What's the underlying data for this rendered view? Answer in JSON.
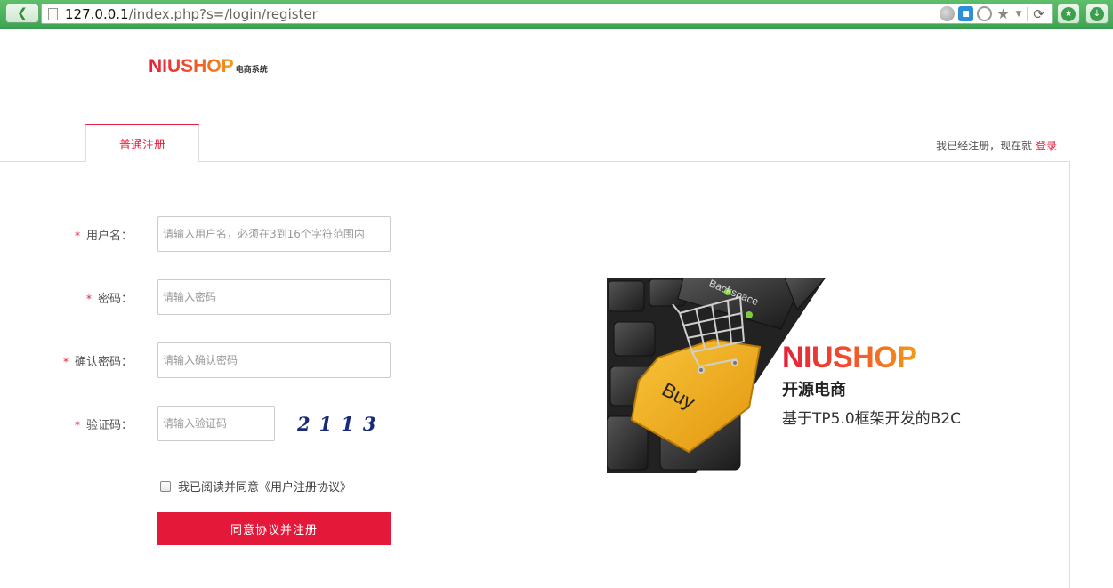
{
  "browser": {
    "url_host": "127.0.0.1",
    "url_path": "/index.php?s=/login/register"
  },
  "logo": {
    "main": "NIUSHOP",
    "sub": "电商系统"
  },
  "tabs": [
    {
      "label": "普通注册"
    }
  ],
  "login_hint": {
    "text": "我已经注册，现在就",
    "link": "登录"
  },
  "form": {
    "required_mark": "*",
    "username": {
      "label": "用户名：",
      "placeholder": "请输入用户名，必须在3到16个字符范围内"
    },
    "password": {
      "label": "密码：",
      "placeholder": "请输入密码"
    },
    "confirm_password": {
      "label": "确认密码：",
      "placeholder": "请输入确认密码"
    },
    "captcha": {
      "label": "验证码：",
      "placeholder": "请输入验证码",
      "image_text": "2113"
    },
    "agreement": "我已阅读并同意《用户注册协议》",
    "submit_label": "同意协议并注册"
  },
  "ad": {
    "brand": "NIUSHOP",
    "title": "开源电商",
    "desc": "基于TP5.0框架开发的B2C",
    "key_backspace": "Backspace",
    "key_buy": "Buy"
  },
  "colors": {
    "accent": "#e4193a",
    "chrome": "#4cb35c"
  }
}
